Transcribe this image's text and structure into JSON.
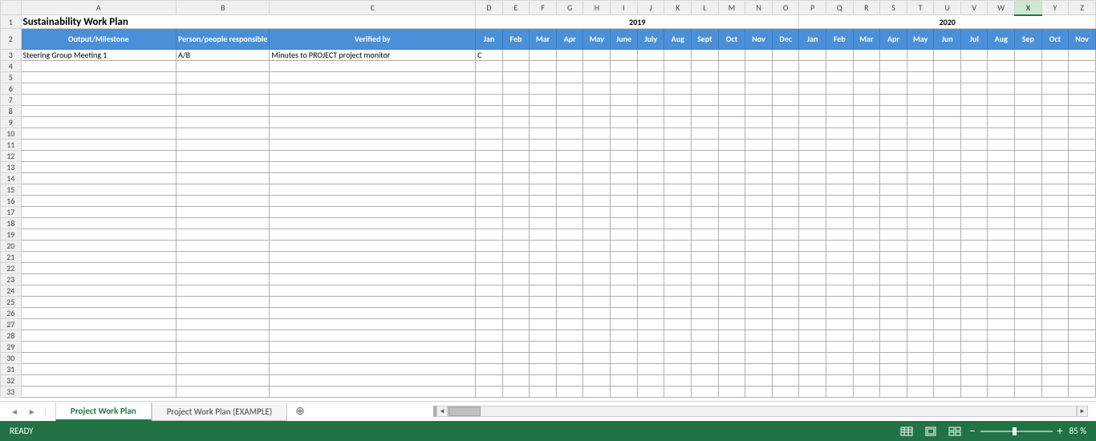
{
  "columns": {
    "letters": [
      "A",
      "B",
      "C",
      "D",
      "E",
      "F",
      "G",
      "H",
      "I",
      "J",
      "K",
      "L",
      "M",
      "N",
      "O",
      "P",
      "Q",
      "R",
      "S",
      "T",
      "U",
      "V",
      "W",
      "X",
      "Y",
      "Z"
    ],
    "widths": [
      196,
      100,
      260,
      34,
      34,
      34,
      34,
      34,
      34,
      34,
      34,
      34,
      34,
      34,
      34,
      34,
      34,
      34,
      34,
      34,
      34,
      34,
      34,
      34,
      34,
      34
    ],
    "selected": "X"
  },
  "row_nums": [
    1,
    2,
    3,
    4,
    5,
    6,
    7,
    8,
    9,
    10,
    11,
    12,
    13,
    14,
    15,
    16,
    17,
    18,
    19,
    20,
    21,
    22,
    23,
    24,
    25,
    26,
    27,
    28,
    29,
    30,
    31,
    32,
    33
  ],
  "title": "Sustainability Work Plan",
  "years": {
    "y1": "2019",
    "y2": "2020"
  },
  "headers": {
    "col_a": "Output/Milestone",
    "col_b": "Person/people responsible",
    "col_c": "Verified by",
    "months": [
      "Jan",
      "Feb",
      "Mar",
      "Apr",
      "May",
      "June",
      "July",
      "Aug",
      "Sept",
      "Oct",
      "Nov",
      "Dec",
      "Jan",
      "Feb",
      "Mar",
      "Apr",
      "May",
      "Jun",
      "Jul",
      "Aug",
      "Sep",
      "Oct",
      "Nov"
    ]
  },
  "data_row": {
    "a": "Steering Group Meeting 1",
    "b": "A/B",
    "c": "Minutes to PROJECT project monitor",
    "d": "C"
  },
  "tabs": {
    "active": "Project Work Plan",
    "other": "Project Work Plan (EXAMPLE)"
  },
  "status": {
    "ready": "READY",
    "zoom": "85 %"
  }
}
